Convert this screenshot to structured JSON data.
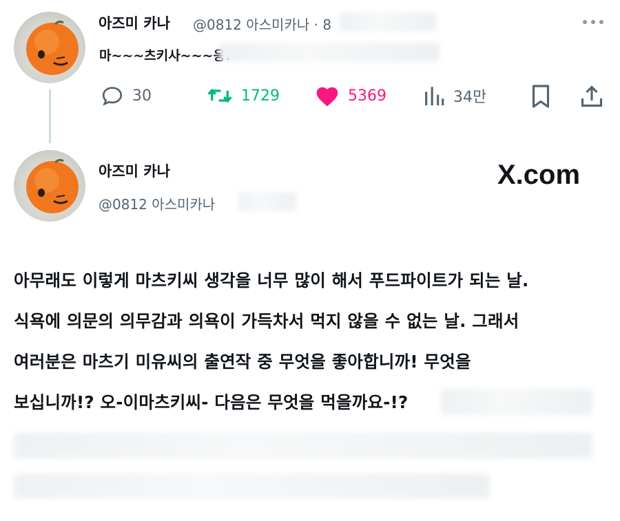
{
  "reply_tweet": {
    "display_name": "아즈미 카나",
    "handle_meta": "@0812 아스미카나 · 8",
    "text": "마~~~츠키사~~~응!",
    "actions": {
      "replies": "30",
      "retweets": "1729",
      "likes": "5369",
      "views": "34만"
    },
    "icons": [
      "more-icon",
      "reply-icon",
      "retweet-icon",
      "heart-icon",
      "views-icon",
      "bookmark-icon",
      "share-icon"
    ]
  },
  "main_tweet": {
    "display_name": "아즈미 카나",
    "handle": "@0812 아스미카나",
    "body_lines": [
      "아무래도 이렇게 마츠키씨 생각을 너무 많이 해서 푸드파이트가 되는 날.",
      "식욕에 의문의 의무감과 의욕이 가득차서 먹지 않을 수 없는 날. 그래서",
      "여러분은 마츠기 미유씨의 출연작 중 무엇을 좋아합니까! 무엇을",
      "보십니까!? 오-이마츠키씨- 다음은 무엇을 먹을까요-!?"
    ]
  },
  "watermark": "X.com",
  "colors": {
    "retweet_green": "#00ba7c",
    "like_pink": "#f91880",
    "gray_text": "#536471",
    "orange_avatar": "#f0771f"
  }
}
